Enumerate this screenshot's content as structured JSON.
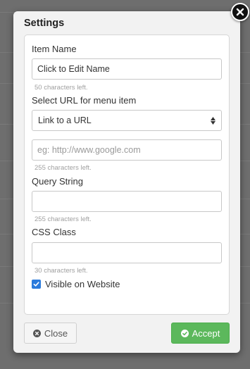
{
  "dialog": {
    "title": "Settings",
    "item_name": {
      "label": "Item Name",
      "value": "Click to Edit Name",
      "hint": "50 characters left."
    },
    "url_select": {
      "label": "Select URL for menu item",
      "selected": "Link to a URL"
    },
    "url_input": {
      "placeholder": "eg: http://www.google.com",
      "value": "",
      "hint": "255 characters left."
    },
    "query_string": {
      "label": "Query String",
      "value": "",
      "hint": "255 characters left."
    },
    "css_class": {
      "label": "CSS Class",
      "value": "",
      "hint": "30 characters left."
    },
    "visible": {
      "label": "Visible on Website",
      "checked": true
    },
    "buttons": {
      "close": "Close",
      "accept": "Accept"
    }
  },
  "icons": {
    "dialog_close": "close-icon",
    "close_button": "times-circle-icon",
    "accept_button": "check-circle-icon",
    "select_arrows": "sort-icon",
    "checkbox": "check-icon"
  },
  "colors": {
    "accept": "#5cb85c",
    "checkbox": "#2b7bdc",
    "backdrop": "#6e6e6e"
  }
}
